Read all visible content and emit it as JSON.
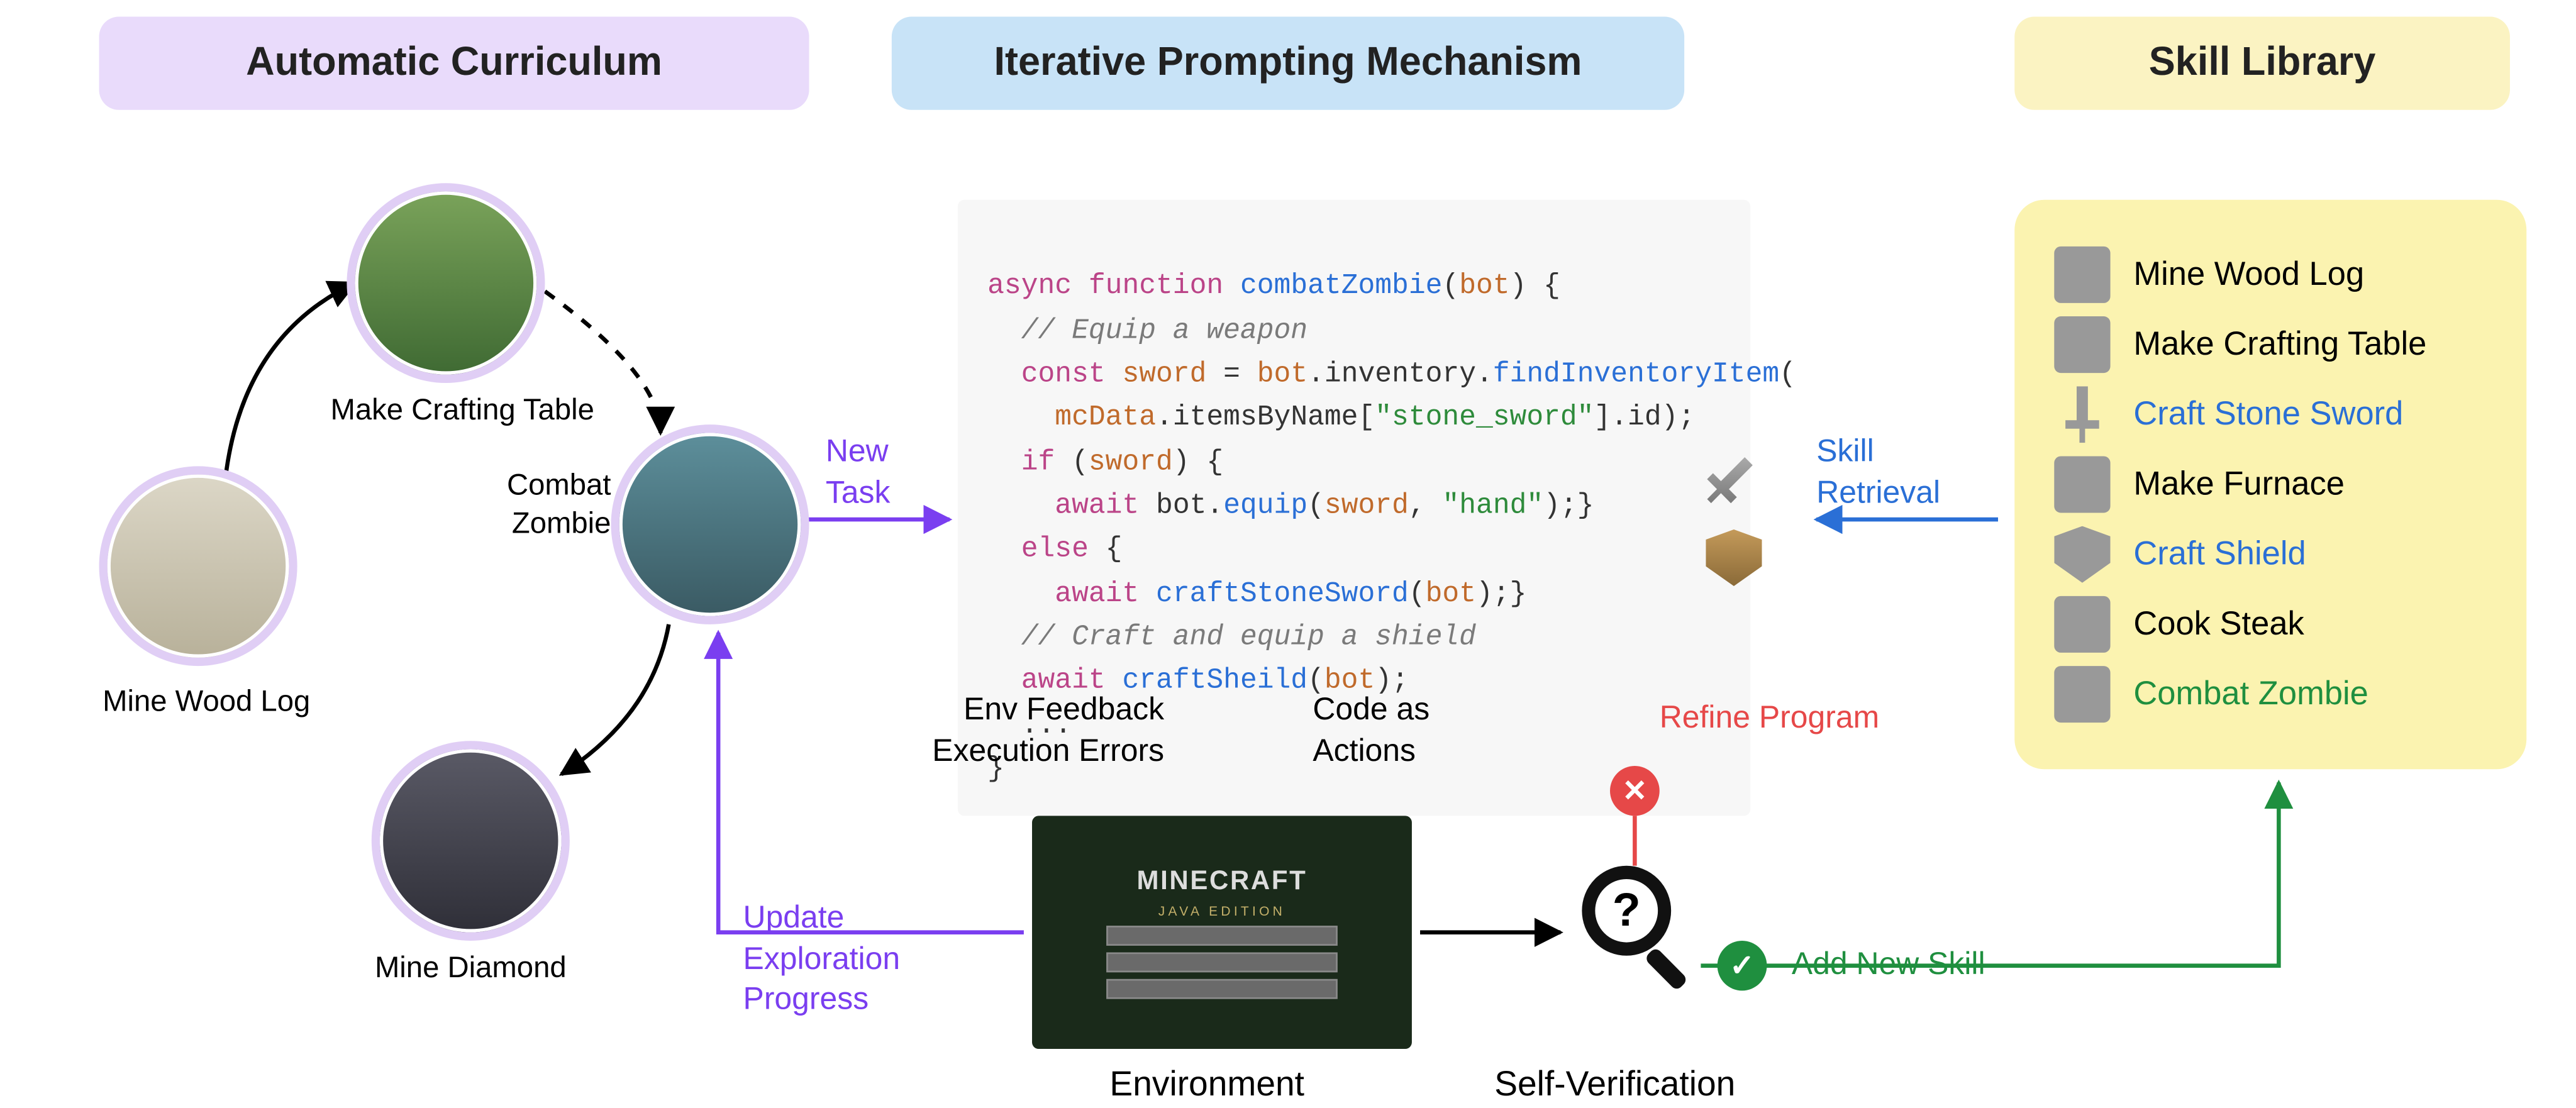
{
  "headers": {
    "curriculum": "Automatic Curriculum",
    "prompting": "Iterative Prompting Mechanism",
    "skills": "Skill Library"
  },
  "curriculum": {
    "wood": {
      "label": "Mine Wood Log"
    },
    "table": {
      "label": "Make Crafting Table"
    },
    "zombie": {
      "label": "Combat\nZombie"
    },
    "diamond": {
      "label": "Mine Diamond"
    }
  },
  "arrows": {
    "new_task": "New\nTask",
    "skill_retrieval": "Skill\nRetrieval",
    "env_feedback": "Env Feedback\nExecution Errors",
    "code_actions": "Code as\nActions",
    "refine": "Refine Program",
    "add_skill": "Add New Skill",
    "update_progress": "Update\nExploration\nProgress"
  },
  "bottom_labels": {
    "environment": "Environment",
    "self_verify": "Self-Verification"
  },
  "code": {
    "l1a": "async",
    "l1b": "function",
    "l1c": "combatZombie",
    "l1d": "bot",
    "l1e": ") {",
    "l2": "// Equip a weapon",
    "l3a": "const",
    "l3b": "sword",
    "l3c": " = ",
    "l3d": "bot",
    "l3e": ".inventory.",
    "l3f": "findInventoryItem",
    "l3g": "(",
    "l4a": "mcData",
    "l4b": ".itemsByName[",
    "l4c": "\"stone_sword\"",
    "l4d": "].id);",
    "l5a": "if",
    "l5b": " (",
    "l5c": "sword",
    "l5d": ") {",
    "l6a": "await",
    "l6b": " bot.",
    "l6c": "equip",
    "l6d": "(",
    "l6e": "sword",
    "l6f": ", ",
    "l6g": "\"hand\"",
    "l6h": ");}",
    "l7a": "else",
    "l7b": " {",
    "l8a": "await",
    "l8b": " ",
    "l8c": "craftStoneSword",
    "l8d": "(",
    "l8e": "bot",
    "l8f": ");}",
    "l9": "// Craft and equip a shield",
    "l10a": "await",
    "l10b": " ",
    "l10c": "craftSheild",
    "l10d": "(",
    "l10e": "bot",
    "l10f": ");",
    "l11": "...",
    "l12": "}"
  },
  "skills": {
    "items": [
      {
        "icon": "log",
        "label": "Mine Wood  Log",
        "color": "black"
      },
      {
        "icon": "table",
        "label": "Make Crafting Table",
        "color": "black"
      },
      {
        "icon": "sword",
        "label": "Craft Stone Sword",
        "color": "blue"
      },
      {
        "icon": "furn",
        "label": "Make Furnace",
        "color": "black"
      },
      {
        "icon": "shield",
        "label": "Craft Shield",
        "color": "blue"
      },
      {
        "icon": "steak",
        "label": "Cook Steak",
        "color": "black"
      },
      {
        "icon": "zombie",
        "label": "Combat Zombie",
        "color": "green"
      }
    ]
  },
  "env": {
    "logo": "MINECRAFT",
    "sub": "JAVA EDITION"
  }
}
